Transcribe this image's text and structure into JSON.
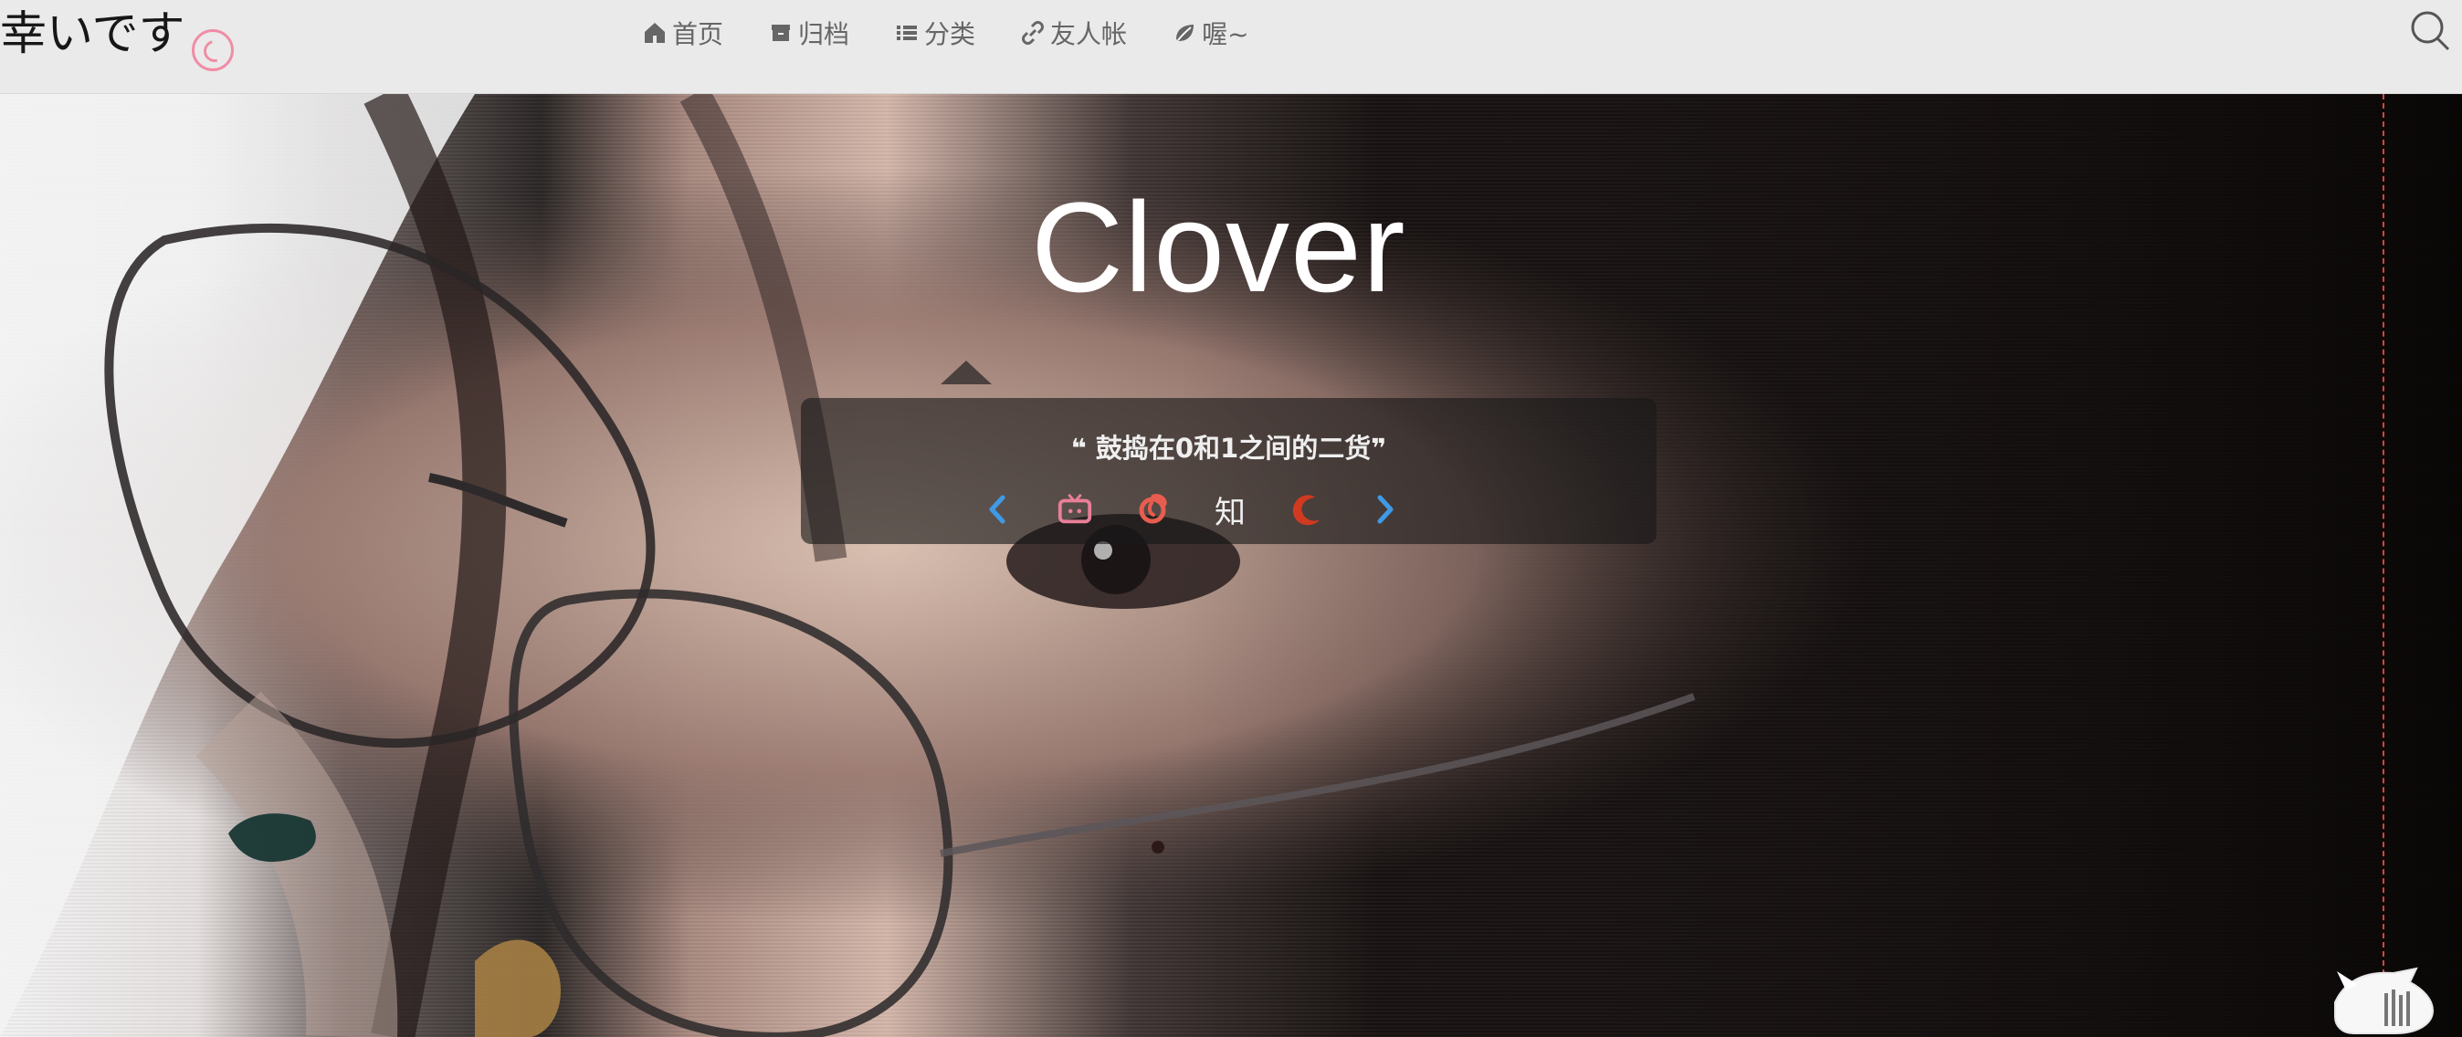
{
  "brand": {
    "text": "幸いです"
  },
  "nav": {
    "items": [
      {
        "label": "首页",
        "icon": "home-icon"
      },
      {
        "label": "归档",
        "icon": "archive-icon"
      },
      {
        "label": "分类",
        "icon": "list-icon"
      },
      {
        "label": "友人帐",
        "icon": "link-icon"
      },
      {
        "label": "喔~",
        "icon": "leaf-icon"
      }
    ]
  },
  "hero": {
    "title": "Clover",
    "motto": "❝ 鼓捣在0和1之间的二货❞"
  },
  "social": {
    "items": [
      {
        "icon": "chevron-left-icon"
      },
      {
        "icon": "bilibili-tv-icon"
      },
      {
        "icon": "netease-music-icon"
      },
      {
        "icon": "zhihu-icon",
        "label": "知"
      },
      {
        "icon": "crescent-icon"
      },
      {
        "icon": "chevron-right-icon"
      }
    ]
  },
  "colors": {
    "header_bg": "#f7f7f7",
    "brand_accent": "#f08da6",
    "nav_text": "#666666",
    "title_text": "#ffffff",
    "motto_text": "#efefef",
    "blue_accent": "#3f9ae6",
    "pink_tv": "#ea7f99",
    "netease_red": "#e85d4e",
    "crescent_red": "#d13a20",
    "divider_red": "#d8433f"
  }
}
